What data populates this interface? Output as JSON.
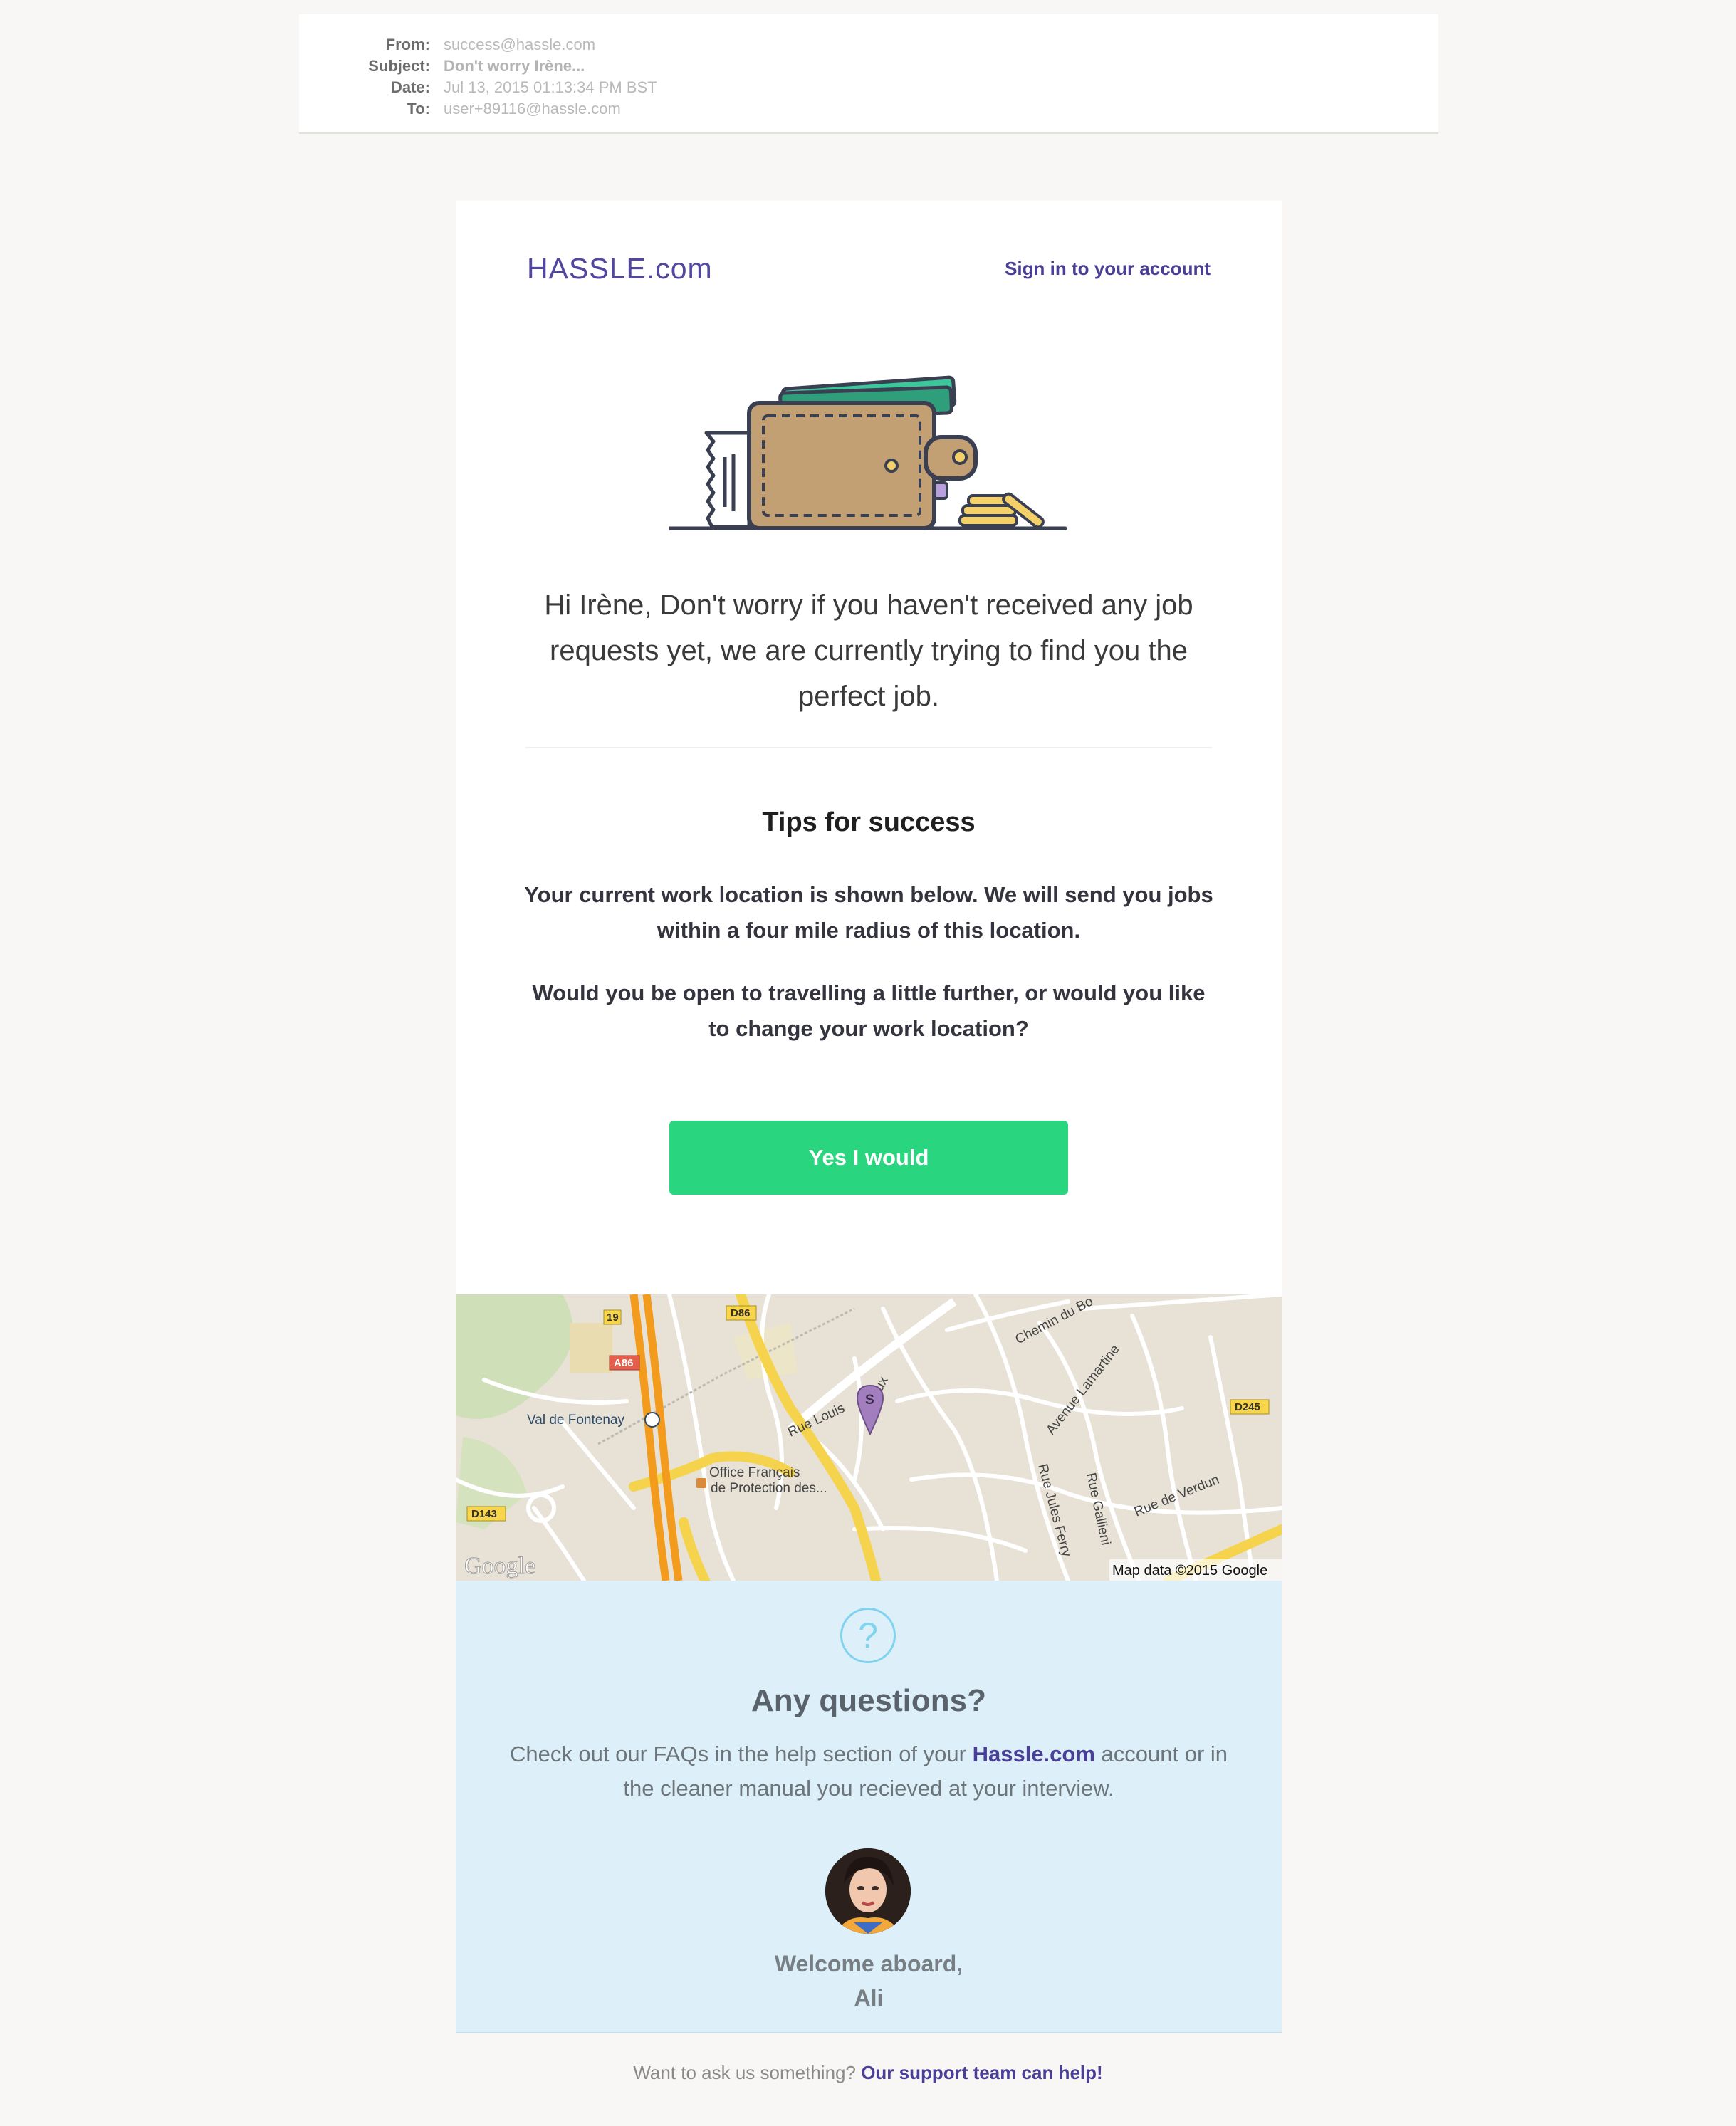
{
  "mail_header": {
    "from_label": "From:",
    "from_value": "success@hassle.com",
    "subject_label": "Subject:",
    "subject_value": "Don't worry Irène...",
    "date_label": "Date:",
    "date_value": "Jul 13, 2015 01:13:34 PM BST",
    "to_label": "To:",
    "to_value": "user+89116@hassle.com"
  },
  "email": {
    "logo": "HASSLE.com",
    "signin_link": "Sign in to your account",
    "greeting": "Hi Irène, Don't worry if you haven't received any job requests yet, we are currently trying to find you the perfect job.",
    "tips_title": "Tips for success",
    "tip_location": "Your current work location is shown below. We will send you jobs within a four mile radius of this location.",
    "tip_travel": "Would you be open to travelling a little further, or would you like to change your work location?",
    "cta_label": "Yes I would"
  },
  "map": {
    "labels": {
      "road_19": "19",
      "road_d86": "D86",
      "road_a86": "A86",
      "road_d245": "D245",
      "road_d143": "D143",
      "val_de_fontenay": "Val de Fontenay",
      "rue_louis": "Rue Louis",
      "roux": "roux",
      "chemin": "Chemin du Bo",
      "avenue_lamartine": "Avenue Lamartine",
      "office_1": "Office Français",
      "office_2": "de Protection des...",
      "rue_jules_ferry": "Rue Jules Ferry",
      "rue_gallieni": "Rue Gallieni",
      "rue_de_verdun": "Rue de Verdun",
      "marker_letter": "S",
      "google_logo": "Google",
      "attribution": "Map data ©2015 Google"
    },
    "colors": {
      "land": "#e7e1d6",
      "road": "#ffffff",
      "highway": "#f29b1d",
      "primary": "#f6d34c",
      "marker": "#a27ebe"
    }
  },
  "questions": {
    "icon_glyph": "?",
    "title": "Any questions?",
    "text_before": "Check out our FAQs in the help section of your",
    "brand_link": "Hassle.com",
    "text_after": "account or in the cleaner manual you recieved at your interview.",
    "sign_line1": "Welcome aboard,",
    "sign_line2": "Ali"
  },
  "footer": {
    "prompt": "Want to ask us something?",
    "support_link": "Our support team can help!"
  },
  "icons": [
    "wallet-illustration",
    "question-icon",
    "map-marker-icon",
    "avatar"
  ],
  "colors": {
    "brand": "#4a3f96",
    "cta": "#2ad57f",
    "questions_bg": "#ddf0fa",
    "page_bg": "#f8f7f5"
  }
}
